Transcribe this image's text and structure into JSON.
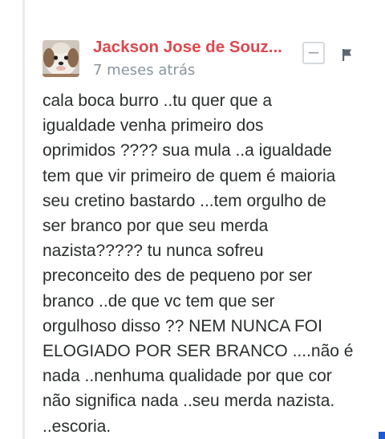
{
  "comment": {
    "author": "Jackson Jose de Souz...",
    "timestamp": "7 meses atrás",
    "collapse_label": "−",
    "avatar_icon": "dog-avatar",
    "flag_icon": "flag-icon",
    "body_lines": [
      "cala boca burro ..tu quer que a",
      "igualdade venha primeiro dos",
      "oprimidos ???? sua mula ..a igualdade",
      "tem que vir primeiro de quem é maioria",
      "seu cretino bastardo ...tem orgulho de",
      "ser branco por que seu merda",
      "nazista????? tu nunca sofreu",
      "preconceito des de pequeno por ser",
      "branco ..de que vc tem que ser",
      "orgulhoso disso ?? NEM NUNCA FOI",
      "ELOGIADO POR SER BRANCO ....não é",
      "nada ..nenhuma qualidade por que cor",
      "não significa nada ..seu merda nazista.",
      "..escoria."
    ]
  },
  "colors": {
    "author": "#e0474c",
    "text": "#2a2e2e",
    "meta": "#8a949e",
    "accent": "#1e5bd3"
  }
}
